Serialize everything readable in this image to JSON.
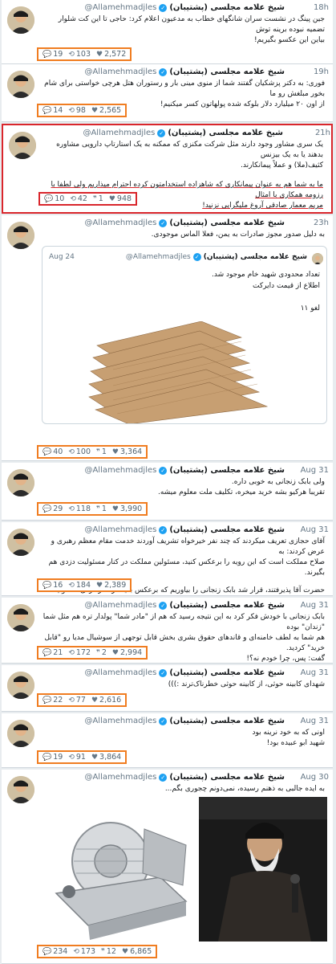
{
  "account": {
    "name": "شیخ علامه مجلسی (پشتیبان)",
    "handle": "@Allamehmadjles",
    "verified_icon": "verified-badge-icon"
  },
  "colors": {
    "highlight_red": "#d9262c",
    "highlight_orange": "#f07d21",
    "verified_blue": "#1da1f2"
  },
  "tweets": [
    {
      "time": "18h",
      "lines": [
        "جین پینگ در نشست سران شانگهای خطاب به مدعیون اعلام کرد: حاجی تا این کت شلوار تضمیه نبوده برینه توش",
        "بیاین این عکسو بگیریم!"
      ],
      "replies": "19",
      "retweets": "103",
      "likes": "2,572"
    },
    {
      "time": "19h",
      "lines": [
        "فوری: به دکتر پزشکیان گفتند شما از منوی مینی بار و رستوران هتل هرچی خواستی برای شام بخور مبلغش رو ما",
        "از اون ۲۰ میلیارد دلار بلوکه شده پولهاتون کسر میکنیم!"
      ],
      "replies": "14",
      "retweets": "98",
      "likes": "2,565"
    },
    {
      "time": "21h",
      "lines": [
        "یک سری مشاور وجود دارند مثل شرکت مکنزی که ممکنه به یک استارتاپ دارویی مشاوره بدهند یا به یک بیزنس",
        "کثیف(ملا) و عملاً پیمانکارند.",
        "ما به شما هم به عنوان پیمانکاری که شاهزاده استخدامتون کرده احترام میذاریم ولی لطفا با رزومه همکاری با امثال",
        "مریم معمار صادقی آروغ ملیگرایی نزنید!"
      ],
      "replies": "10",
      "retweets": "42",
      "quotes": "1",
      "likes": "948"
    },
    {
      "time": "23h",
      "lines": [
        "به دلیل صدور مجوز صادرات به یمن، فعلا الماس موجودی."
      ],
      "quote": {
        "name": "شیخ علامه مجلسی (پشتیبان)",
        "handle": "@Allamehmadjles",
        "date": "Aug 24",
        "lines": [
          "تعداد محدودی شهید خام موجود شد.",
          "اطلاع از قیمت دایرکت",
          "",
          "لغو ۱۱"
        ]
      },
      "replies": "40",
      "retweets": "100",
      "quotes": "1",
      "likes": "3,364"
    },
    {
      "time": "Aug 31",
      "lines": [
        "ولی بابک زنجانی به خوبی داره.",
        "تقریبا هرکیو بشه خرید میخره، تکلیف ملت معلوم میشه."
      ],
      "replies": "29",
      "retweets": "118",
      "quotes": "1",
      "likes": "3,990"
    },
    {
      "time": "Aug 31",
      "lines": [
        "آقای حجازی تعریف میکردند که چند نفر خیرخواه تشریف آوردند خدمت مقام معظم رهبری و عرض کردند: به",
        "صلاح مملکت است که این رویه را برعکس کنید، مسئولین مملکت در کنار مسئولیت دزدی هم بگیرند.",
        "",
        "حضرت آقا پذیرفتند، قرار شد بابک زنجانی را بیاوریم که برعکس بقیه در کنار دزدی مسئولیت هم بگیرد."
      ],
      "replies": "16",
      "retweets": "184",
      "likes": "2,389"
    },
    {
      "time": "Aug 31",
      "lines": [
        "بابک زنجانی با خودش فکر کرد به این نتیجه رسید که هم از \"مادر شما\" پولدار تره هم مثل شما \"زندان\" بوده",
        "هم شما به لطف خامنه‌ای و قاند‌های حقوق بشری بخش قابل توجهی از سوشیال مدیا رو \"قابل خرید\" کردید.",
        "گفت: پس، چرا خودم نه؟!"
      ],
      "replies": "21",
      "retweets": "172",
      "quotes": "2",
      "likes": "2,994"
    },
    {
      "time": "Aug 31",
      "lines": [
        "شهدای کابینه حوثی، از کابینه حوثی خطرناک‌ترند :)))"
      ],
      "replies": "22",
      "retweets": "77",
      "likes": "2,616"
    },
    {
      "time": "Aug 31",
      "lines": [
        "اونی که به خود نرینه بود",
        "شهید ابو عبیده بود!"
      ],
      "replies": "19",
      "retweets": "91",
      "likes": "3,864"
    },
    {
      "time": "Aug 30",
      "lines": [
        "به ایده جالبی به ذهنم رسیده، نمی‌دونم چجوری بگم..."
      ],
      "replies": "234",
      "retweets": "173",
      "quotes": "12",
      "likes": "6,865"
    }
  ]
}
